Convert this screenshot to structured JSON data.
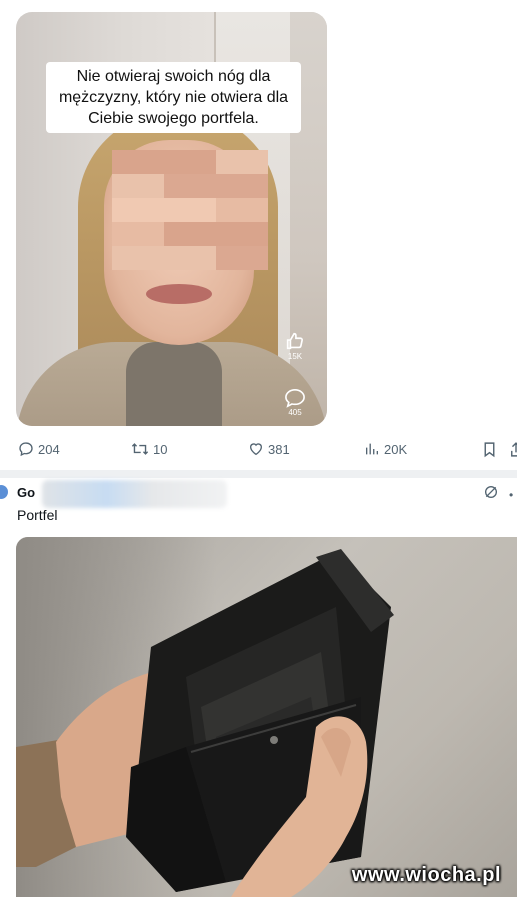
{
  "video": {
    "caption": "Nie otwieraj swoich nóg dla mężczyzny, który nie otwiera dla Ciebie swojego portfela.",
    "side_likes": "15K",
    "side_comments": "405"
  },
  "actions": {
    "replies": "204",
    "reposts": "10",
    "likes": "381",
    "views": "20K",
    "icons": [
      "reply-icon",
      "repost-icon",
      "heart-icon",
      "views-icon",
      "bookmark-icon",
      "share-icon"
    ]
  },
  "post2": {
    "author_visible": "Go",
    "text": "Portfel"
  },
  "watermark": "www.wiocha.pl",
  "colors": {
    "muted": "#536471",
    "text": "#0f1419",
    "divider": "#eef0f2"
  }
}
